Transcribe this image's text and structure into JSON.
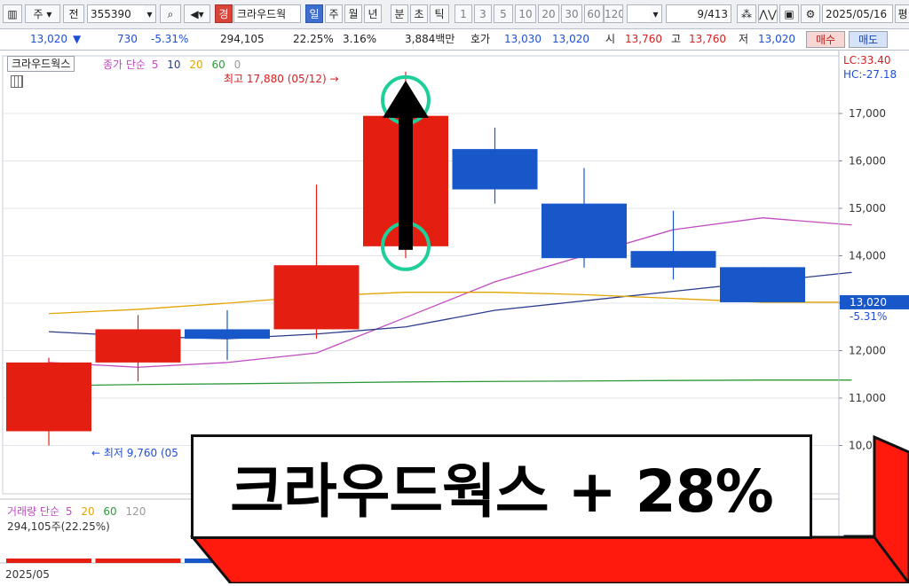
{
  "toolbar": {
    "type_label": "주",
    "prefix_label": "전",
    "code": "355390",
    "stock_name": "크라우드웍",
    "prefix_red": "경",
    "periods": [
      "일",
      "주",
      "월",
      "년",
      "분",
      "초",
      "틱"
    ],
    "selected_period": "일",
    "intervals": [
      "1",
      "3",
      "5",
      "10",
      "20",
      "30",
      "60",
      "120"
    ],
    "page_count": "9/413",
    "date": "2025/05/16",
    "last_btn": "평"
  },
  "quote": {
    "price": "13,020",
    "change": "730",
    "change_pct": "-5.31%",
    "volume": "294,105",
    "volume_pct": "22.25%",
    "turnover_pct": "3.16%",
    "amount": "3,884백만",
    "bid_label": "호가",
    "bid_price": "13,030",
    "ask_price": "13,020",
    "open_label": "시",
    "open": "13,760",
    "high_label": "고",
    "high": "13,760",
    "low_label": "저",
    "low": "13,020",
    "buy_label": "매수",
    "sell_label": "매도"
  },
  "chart_data": {
    "type": "candlestick",
    "title": "크라우드웍스",
    "legend": {
      "prefix": "종가 단순",
      "periods": [
        "5",
        "10",
        "20",
        "60",
        "0"
      ],
      "colors": [
        "#c04cc0",
        "#2a3c8c",
        "#e2a400",
        "#2d9a3a",
        "#9a9a9a"
      ]
    },
    "candles": [
      {
        "open": 10300,
        "close": 11750,
        "high": 11850,
        "low": 10000
      },
      {
        "open": 11750,
        "close": 12450,
        "high": 12750,
        "low": 11350
      },
      {
        "open": 12450,
        "close": 12250,
        "high": 12850,
        "low": 11800
      },
      {
        "open": 12450,
        "close": 13800,
        "high": 15500,
        "low": 12250
      },
      {
        "open": 14200,
        "close": 16950,
        "high": 17880,
        "low": 13950
      },
      {
        "open": 16250,
        "close": 15400,
        "high": 16700,
        "low": 15100
      },
      {
        "open": 15100,
        "close": 13950,
        "high": 15850,
        "low": 13750
      },
      {
        "open": 14100,
        "close": 13750,
        "high": 14950,
        "low": 13500
      },
      {
        "open": 13760,
        "close": 13020,
        "high": 13760,
        "low": 13020
      }
    ],
    "up_color": "#e41e10",
    "down_color": "#1757c9",
    "ma": [
      {
        "period": "5",
        "color": "#c04cc0",
        "values": [
          11750,
          11650,
          11750,
          11950,
          12700,
          13450,
          14000,
          14550,
          14800,
          14650
        ]
      },
      {
        "period": "10",
        "color": "#2a3c8c",
        "values": [
          12400,
          12300,
          12250,
          12350,
          12500,
          12850,
          13050,
          13250,
          13450,
          13650
        ]
      },
      {
        "period": "20",
        "color": "#e2a400",
        "values": [
          12780,
          12870,
          13000,
          13150,
          13230,
          13230,
          13180,
          13100,
          13020,
          13020
        ]
      },
      {
        "period": "60",
        "color": "#2d9a3a",
        "values": [
          11260,
          11285,
          11300,
          11320,
          11340,
          11350,
          11360,
          11370,
          11380,
          11380
        ]
      }
    ],
    "ylim": [
      9500,
      18600
    ],
    "yticks": [
      "17,000",
      "16,000",
      "15,000",
      "14,000",
      "13,000",
      "12,000",
      "11,000",
      "10,000"
    ],
    "ytick_values": [
      17000,
      16000,
      15000,
      14000,
      13000,
      12000,
      11000,
      10000
    ],
    "current_price_label": "13,020",
    "current_pct_label": "-5.31%",
    "top_right_1": "LC:33.40",
    "top_right_2": "HC:-27.18",
    "high_annotation": "최고 17,880 (05/12)",
    "low_annotation": "최저 9,760 (05",
    "volume_panel": {
      "legend_prefix": "거래량 단순",
      "periods": [
        "5",
        "20",
        "60",
        "120"
      ],
      "colors": [
        "#c04cc0",
        "#e2a400",
        "#2d9a3a",
        "#9a9a9a"
      ],
      "value_label": "294,105주(22.25%)"
    },
    "x_label": "2025/05"
  },
  "banner": {
    "text": "크라우드웍스 + 28%"
  }
}
